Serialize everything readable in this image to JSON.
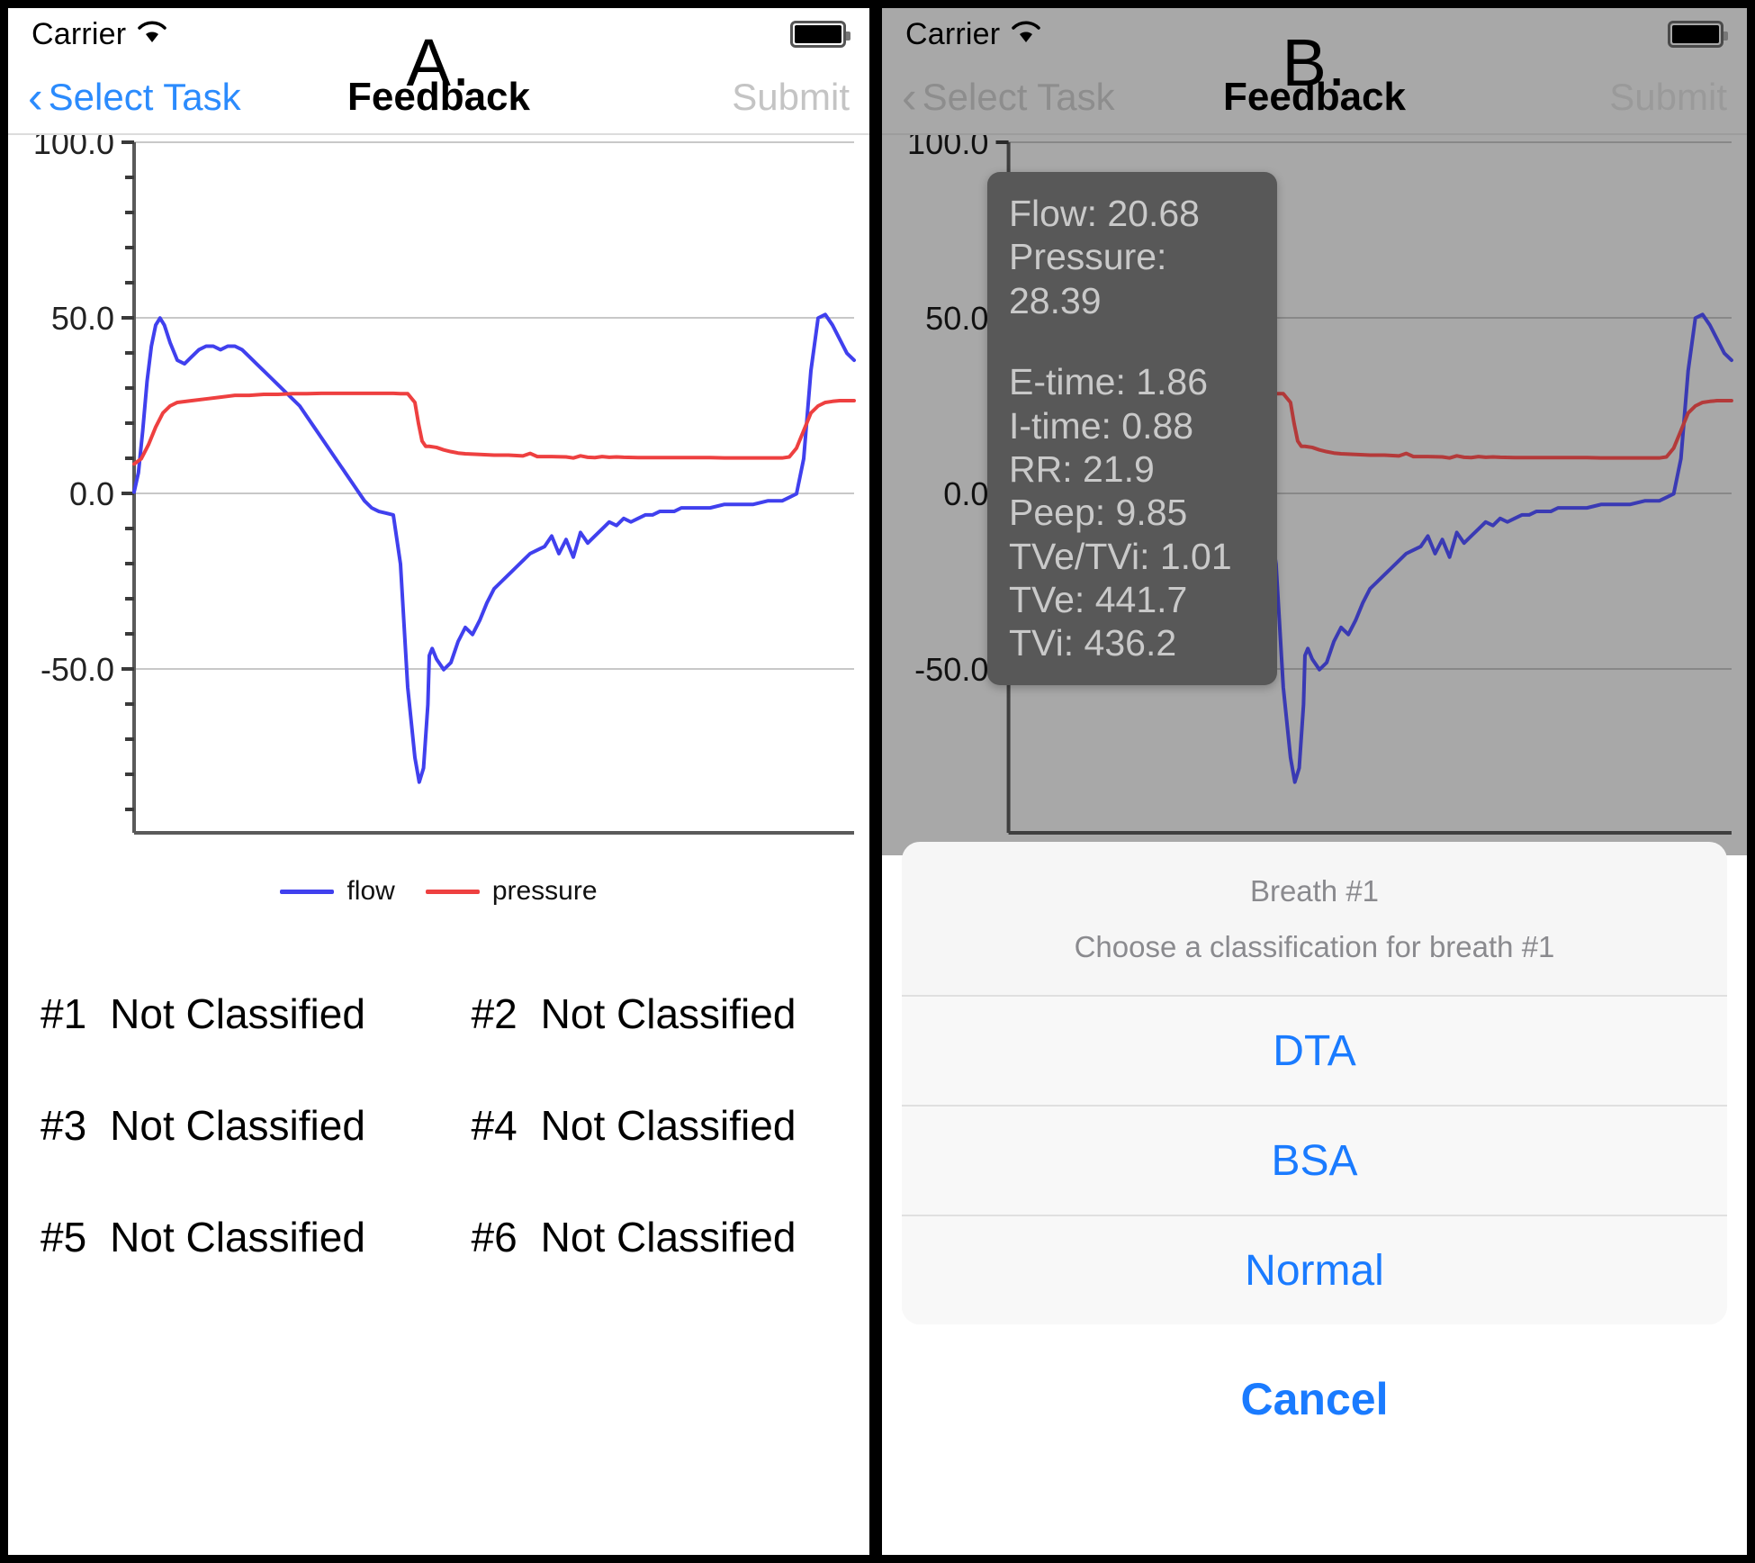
{
  "panels": [
    {
      "letter": "A.",
      "statusbar": {
        "carrier": "Carrier",
        "wifi_icon": "wifi-icon",
        "battery_icon": "battery-icon"
      },
      "nav": {
        "back": "Select Task",
        "back_chevron_icon": "chevron-left-icon",
        "title": "Feedback",
        "submit": "Submit"
      }
    },
    {
      "letter": "B.",
      "statusbar": {
        "carrier": "Carrier",
        "wifi_icon": "wifi-icon",
        "battery_icon": "battery-icon"
      },
      "nav": {
        "back": "Select Task",
        "back_chevron_icon": "chevron-left-icon",
        "title": "Feedback",
        "submit": "Submit"
      }
    }
  ],
  "legend": {
    "flow": {
      "label": "flow",
      "color": "#4040ee"
    },
    "pressure": {
      "label": "pressure",
      "color": "#ee4040"
    }
  },
  "classifications": {
    "rows": [
      [
        {
          "num": "#1",
          "value": "Not Classified"
        },
        {
          "num": "#2",
          "value": "Not Classified"
        }
      ],
      [
        {
          "num": "#3",
          "value": "Not Classified"
        },
        {
          "num": "#4",
          "value": "Not Classified"
        }
      ],
      [
        {
          "num": "#5",
          "value": "Not Classified"
        },
        {
          "num": "#6",
          "value": "Not Classified"
        }
      ]
    ]
  },
  "tooltip": {
    "flow": "Flow: 20.68",
    "pressure": "Pressure: 28.39",
    "e_time": "E-time: 1.86",
    "i_time": "I-time: 0.88",
    "rr": "RR: 21.9",
    "peep": "Peep: 9.85",
    "tve_tvi": "TVe/TVi: 1.01",
    "tve": "TVe: 441.7",
    "tvi": "TVi: 436.2"
  },
  "action_sheet": {
    "title": "Breath #1",
    "subtitle": "Choose a classification for breath #1",
    "options": [
      "DTA",
      "BSA",
      "Normal"
    ],
    "cancel": "Cancel",
    "accent_color": "#1a7bff"
  },
  "chart_data": {
    "type": "line",
    "title": "",
    "xlabel": "",
    "ylabel": "",
    "ylim": [
      -100,
      100
    ],
    "yticks": [
      100.0,
      50.0,
      0.0,
      -50.0
    ],
    "ytick_labels": [
      "100.0",
      "50.0",
      "0.0",
      "-50.0"
    ],
    "grid": true,
    "legend_position": "bottom-center",
    "xlim": [
      0,
      100
    ],
    "series": [
      {
        "name": "flow",
        "color": "#4040ee",
        "x": [
          0.0,
          0.6,
          1.2,
          1.8,
          2.4,
          3.0,
          3.6,
          4.2,
          5.0,
          6.0,
          7.0,
          8.0,
          9.0,
          10.0,
          11.0,
          12.0,
          13.0,
          14.0,
          15.0,
          16.0,
          17.0,
          18.0,
          19.0,
          20.0,
          21.0,
          22.0,
          23.0,
          24.0,
          25.0,
          26.0,
          27.0,
          28.0,
          29.0,
          30.0,
          31.0,
          32.0,
          33.0,
          34.0,
          35.0,
          36.0,
          37.0,
          38.0,
          39.0,
          39.6,
          40.2,
          40.8,
          41.0,
          41.4,
          42.0,
          43.0,
          44.0,
          45.0,
          46.0,
          47.0,
          48.0,
          49.0,
          50.0,
          51.0,
          52.0,
          53.0,
          54.0,
          55.0,
          56.0,
          57.0,
          58.0,
          59.0,
          60.0,
          61.0,
          62.0,
          63.0,
          64.0,
          65.0,
          66.0,
          67.0,
          68.0,
          69.0,
          70.0,
          71.0,
          72.0,
          73.0,
          74.0,
          75.0,
          76.0,
          77.0,
          78.0,
          79.0,
          80.0,
          82.0,
          84.0,
          86.0,
          88.0,
          90.0,
          91.0,
          92.0,
          93.0,
          94.0,
          95.0,
          96.0,
          97.0,
          98.0,
          99.0,
          100.0
        ],
        "y": [
          0.5,
          6,
          18,
          32,
          42,
          48,
          50,
          48,
          43,
          38,
          37,
          39,
          41,
          42,
          42,
          41,
          42,
          42,
          41,
          39,
          37,
          35,
          33,
          31,
          29,
          27,
          25,
          22,
          19,
          16,
          13,
          10,
          7,
          4,
          1,
          -2,
          -4,
          -5,
          -5.5,
          -6,
          -20,
          -55,
          -75,
          -82,
          -78,
          -60,
          -46,
          -44,
          -47,
          -50,
          -48,
          -42,
          -38,
          -40,
          -36,
          -31,
          -27,
          -25,
          -23,
          -21,
          -19,
          -17,
          -16,
          -15,
          -12,
          -17,
          -13,
          -18,
          -11,
          -14,
          -12,
          -10,
          -8,
          -9,
          -7,
          -8,
          -7,
          -6,
          -6,
          -5,
          -5,
          -5,
          -4,
          -4,
          -4,
          -4,
          -4,
          -3,
          -3,
          -3,
          -2,
          -2,
          -1,
          0,
          10,
          35,
          50,
          51,
          48,
          44,
          40,
          38
        ]
      },
      {
        "name": "pressure",
        "color": "#ee4040",
        "x": [
          0.0,
          1.0,
          2.0,
          3.0,
          4.0,
          5.0,
          6.0,
          8.0,
          10.0,
          12.0,
          14.0,
          16.0,
          18.0,
          20.0,
          22.0,
          24.0,
          26.0,
          28.0,
          30.0,
          32.0,
          34.0,
          36.0,
          37.0,
          38.0,
          39.0,
          39.5,
          40.0,
          40.5,
          41.0,
          42.0,
          43.0,
          44.0,
          45.0,
          46.0,
          48.0,
          50.0,
          52.0,
          54.0,
          55.0,
          56.0,
          58.0,
          60.0,
          61.0,
          62.0,
          63.0,
          64.0,
          65.0,
          66.0,
          67.0,
          68.0,
          70.0,
          72.0,
          74.0,
          76.0,
          78.0,
          80.0,
          82.0,
          84.0,
          86.0,
          88.0,
          90.0,
          91.0,
          92.0,
          93.0,
          94.0,
          95.0,
          96.0,
          97.0,
          98.0,
          99.0,
          100.0
        ],
        "y": [
          8.5,
          10,
          14,
          19,
          23,
          25,
          26,
          26.5,
          27,
          27.5,
          28,
          28,
          28.3,
          28.3,
          28.5,
          28.5,
          28.6,
          28.6,
          28.6,
          28.6,
          28.6,
          28.6,
          28.5,
          28.5,
          26,
          20,
          15,
          13.5,
          13.5,
          13.2,
          12.5,
          12,
          11.6,
          11.4,
          11.2,
          11,
          11,
          10.8,
          11.5,
          10.6,
          10.6,
          10.5,
          10.2,
          10.8,
          10.4,
          10.3,
          10.6,
          10.4,
          10.5,
          10.4,
          10.3,
          10.3,
          10.3,
          10.3,
          10.3,
          10.3,
          10.2,
          10.2,
          10.2,
          10.2,
          10.2,
          10.5,
          13,
          18,
          23,
          25,
          26,
          26.3,
          26.5,
          26.5,
          26.5
        ]
      }
    ]
  }
}
